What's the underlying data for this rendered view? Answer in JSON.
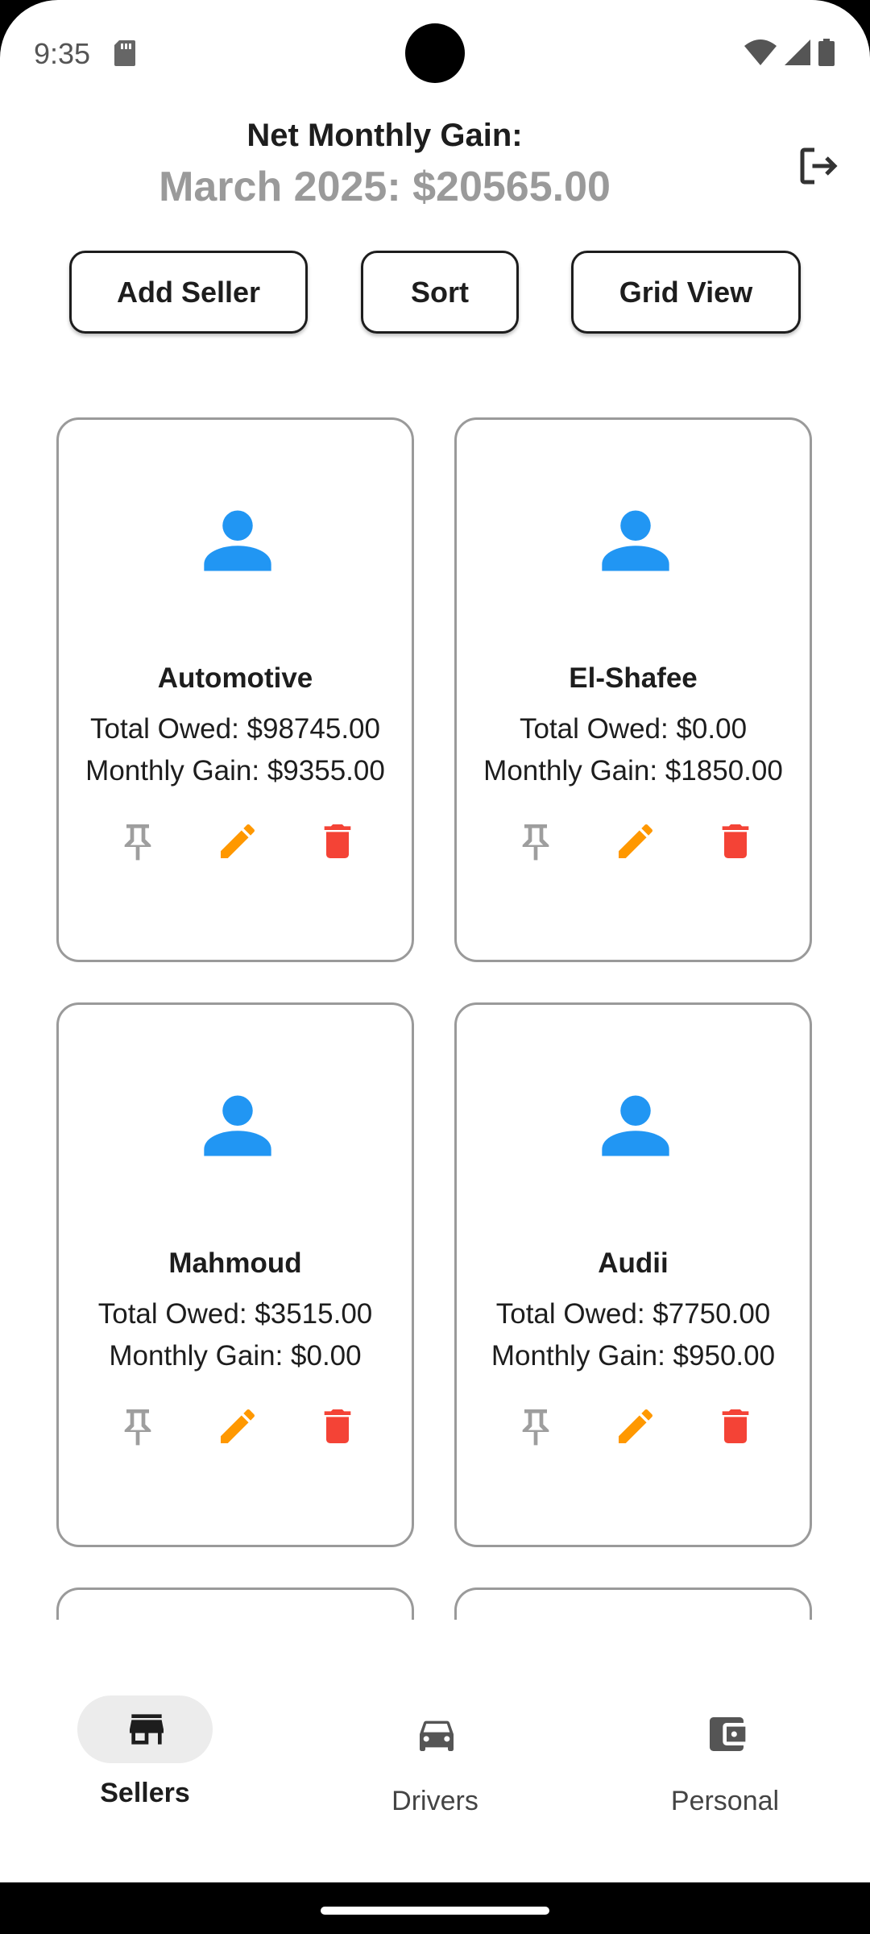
{
  "status_bar": {
    "time": "9:35"
  },
  "header": {
    "title": "Net Monthly Gain:",
    "subtitle": "March 2025: $20565.00"
  },
  "toolbar": {
    "add_label": "Add Seller",
    "sort_label": "Sort",
    "view_label": "Grid View"
  },
  "sellers": [
    {
      "name": "Automotive",
      "owed": "Total Owed: $98745.00",
      "gain": "Monthly Gain: $9355.00"
    },
    {
      "name": "El-Shafee",
      "owed": "Total Owed: $0.00",
      "gain": "Monthly Gain: $1850.00"
    },
    {
      "name": "Mahmoud",
      "owed": "Total Owed: $3515.00",
      "gain": "Monthly Gain: $0.00"
    },
    {
      "name": "Audii",
      "owed": "Total Owed: $7750.00",
      "gain": "Monthly Gain: $950.00"
    }
  ],
  "nav": {
    "items": [
      {
        "label": "Sellers",
        "icon": "store-icon",
        "active": true
      },
      {
        "label": "Drivers",
        "icon": "car-icon",
        "active": false
      },
      {
        "label": "Personal",
        "icon": "wallet-icon",
        "active": false
      }
    ]
  },
  "colors": {
    "avatar": "#2196F3",
    "edit": "#FF9800",
    "delete": "#F44336",
    "pin": "#9E9E9E"
  }
}
